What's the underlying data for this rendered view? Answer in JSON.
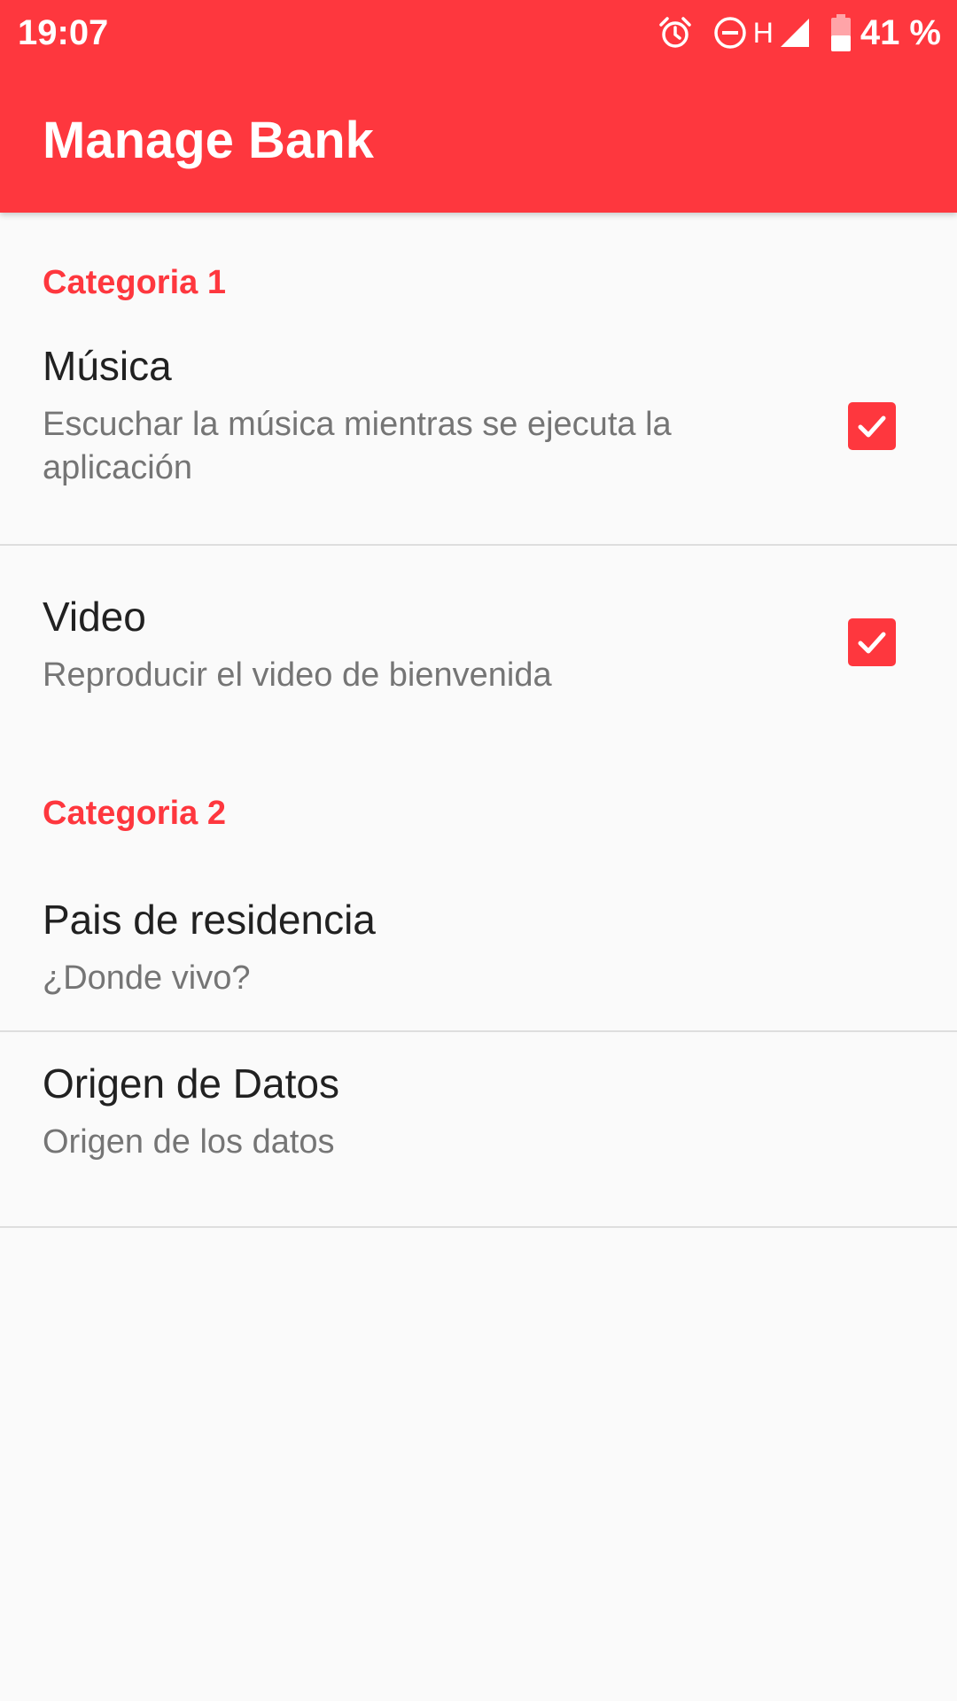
{
  "status_bar": {
    "time": "19:07",
    "network_type": "H",
    "battery_percent": "41 %",
    "icons": [
      "alarm-icon",
      "do-not-disturb-icon",
      "signal-icon",
      "battery-icon"
    ]
  },
  "app_bar": {
    "title": "Manage Bank",
    "color": "#fe373e"
  },
  "settings": {
    "category_1": {
      "title": "Categoria 1",
      "items": [
        {
          "title": "Música",
          "summary": "Escuchar la música mientras se ejecuta la aplicación",
          "checked": true
        },
        {
          "title": "Video",
          "summary": "Reproducir el video de bienvenida",
          "checked": true
        }
      ]
    },
    "category_2": {
      "title": "Categoria 2",
      "items": [
        {
          "title": "Pais de residencia",
          "summary": "¿Donde vivo?"
        },
        {
          "title": "Origen de Datos",
          "summary": "Origen de los datos"
        }
      ]
    }
  }
}
